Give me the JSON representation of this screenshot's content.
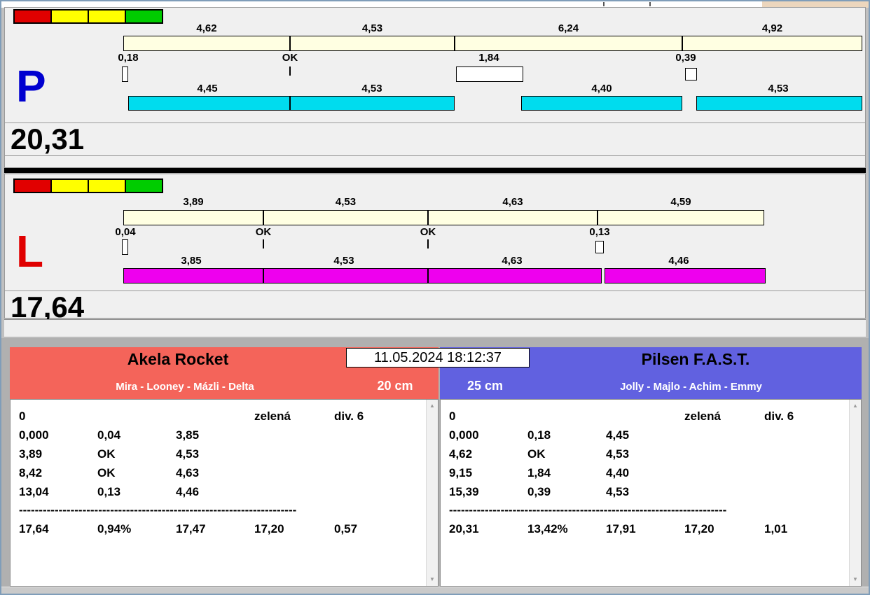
{
  "timestamp": "11.05.2024 18:12:37",
  "icons": {
    "scroll_up": "▲",
    "scroll_down": "▼"
  },
  "traffic_lights": [
    "#e10000",
    "#ffff00",
    "#ffff00",
    "#00cc00"
  ],
  "lanes": [
    {
      "letter": "P",
      "total": "20,31",
      "top_labels": [
        "4,62",
        "4,53",
        "6,24",
        "4,92"
      ],
      "cross_labels": [
        "0,18",
        "OK",
        "1,84",
        "0,39"
      ],
      "bottom_labels": [
        "4,45",
        "4,53",
        "4,40",
        "4,53"
      ],
      "colors": {
        "letter": "#0000d0",
        "bar": "#00dcee"
      }
    },
    {
      "letter": "L",
      "total": "17,64",
      "top_labels": [
        "3,89",
        "4,53",
        "4,63",
        "4,59"
      ],
      "cross_labels": [
        "0,04",
        "OK",
        "OK",
        "0,13"
      ],
      "bottom_labels": [
        "3,85",
        "4,53",
        "4,63",
        "4,46"
      ],
      "colors": {
        "letter": "#e00000",
        "bar": "#ee00ee"
      }
    }
  ],
  "teams": [
    {
      "name": "Akela Rocket",
      "lineup": "Mira - Looney - Mázli - Delta",
      "jump_height": "20 cm",
      "header_color": "#f4645a",
      "log_rows": [
        [
          "0",
          "",
          "",
          "zelená",
          "div. 6"
        ],
        [
          "0,000",
          "0,04",
          "3,85",
          "",
          ""
        ],
        [
          "3,89",
          "OK",
          "4,53",
          "",
          ""
        ],
        [
          "8,42",
          "OK",
          "4,63",
          "",
          ""
        ],
        [
          "13,04",
          "0,13",
          "4,46",
          "",
          ""
        ]
      ],
      "log_divider": "----------------------------------------------------------------------",
      "log_totals": [
        "17,64",
        "0,94%",
        "17,47",
        "17,20",
        "0,57"
      ]
    },
    {
      "name": "Pilsen F.A.S.T.",
      "lineup": "Jolly - Majlo - Achim - Emmy",
      "jump_height": "25 cm",
      "header_color": "#6161e0",
      "log_rows": [
        [
          "0",
          "",
          "",
          "zelená",
          "div. 6"
        ],
        [
          "0,000",
          "0,18",
          "4,45",
          "",
          ""
        ],
        [
          "4,62",
          "OK",
          "4,53",
          "",
          ""
        ],
        [
          "9,15",
          "1,84",
          "4,40",
          "",
          ""
        ],
        [
          "15,39",
          "0,39",
          "4,53",
          "",
          ""
        ]
      ],
      "log_divider": "----------------------------------------------------------------------",
      "log_totals": [
        "20,31",
        "13,42%",
        "17,91",
        "17,20",
        "1,01"
      ]
    }
  ]
}
